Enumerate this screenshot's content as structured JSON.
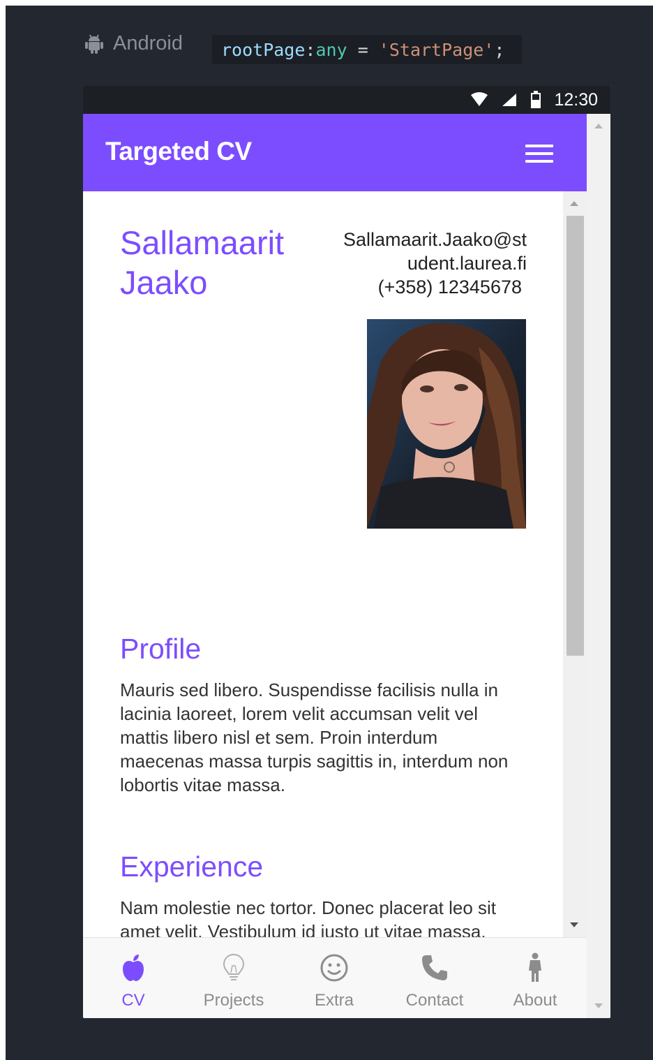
{
  "platform": {
    "label": "Android",
    "icon": "android-icon"
  },
  "code": {
    "ident": "rootPage",
    "colon": ":",
    "type": "any",
    "eq": " = ",
    "value": "'StartPage'",
    "semi": ";"
  },
  "statusbar": {
    "time": "12:30",
    "icons": [
      "wifi-icon",
      "signal-icon",
      "battery-icon"
    ]
  },
  "header": {
    "title": "Targeted CV",
    "menu_icon": "menu-icon"
  },
  "person": {
    "first_name": "Sallamaarit",
    "last_name": "Jaako",
    "email_line1": "Sallamaarit.Jaako@st",
    "email_line2": "udent.laurea.fi",
    "phone": "(+358) 12345678"
  },
  "sections": [
    {
      "title": "Profile",
      "body": "Mauris sed libero. Suspendisse facilisis nulla in lacinia laoreet, lorem velit accumsan velit vel mattis libero nisl et sem. Proin interdum maecenas massa turpis sagittis in, interdum non lobortis vitae massa."
    },
    {
      "title": "Experience",
      "body": "Nam molestie nec tortor. Donec placerat leo sit amet velit. Vestibulum id justo ut vitae massa. Proin in dolor mauris consequat aliquam. Donec ipsum, vestibulum ullamcorper venenatis augue."
    }
  ],
  "tabs": [
    {
      "label": "CV",
      "icon": "apple-icon",
      "active": true
    },
    {
      "label": "Projects",
      "icon": "lightbulb-icon",
      "active": false
    },
    {
      "label": "Extra",
      "icon": "smiley-icon",
      "active": false
    },
    {
      "label": "Contact",
      "icon": "phone-icon",
      "active": false
    },
    {
      "label": "About",
      "icon": "person-icon",
      "active": false
    }
  ],
  "colors": {
    "accent": "#7c4dff",
    "inactive": "#8c8c8c",
    "dark_bg": "#232830"
  }
}
